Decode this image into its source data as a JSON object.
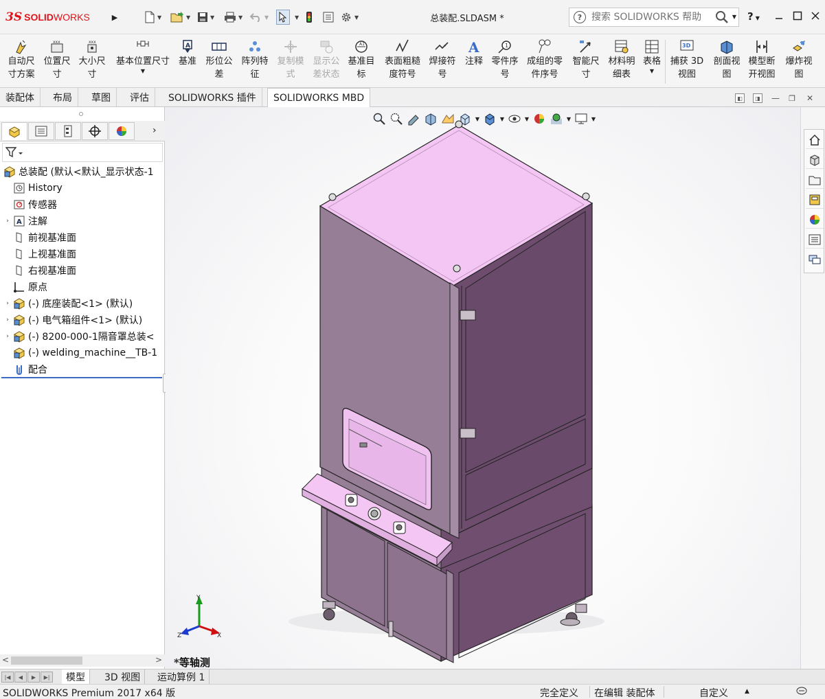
{
  "app": {
    "logo_ds": "3S",
    "logo_solid": "SOLID",
    "logo_works": "WORKS",
    "doc_title": "总装配.SLDASM *",
    "search_placeholder": "搜索 SOLIDWORKS 帮助",
    "help": "?",
    "accent": "#e0131b"
  },
  "ribbon": {
    "buttons": [
      {
        "line1": "自动尺",
        "line2": "寸方案",
        "icon": "auto-dimension-icon"
      },
      {
        "line1": "位置尺",
        "line2": "寸",
        "icon": "location-dimension-icon"
      },
      {
        "line1": "大小尺",
        "line2": "寸",
        "icon": "size-dimension-icon"
      },
      {
        "line1": "基本位置尺寸",
        "line2": "",
        "icon": "basic-location-dimension-icon"
      },
      {
        "line1": "基准",
        "line2": "",
        "icon": "datum-icon"
      },
      {
        "line1": "形位公",
        "line2": "差",
        "icon": "geometric-tolerance-icon"
      },
      {
        "line1": "阵列特",
        "line2": "征",
        "icon": "pattern-feature-icon"
      },
      {
        "line1": "复制模",
        "line2": "式",
        "icon": "copy-scheme-icon"
      },
      {
        "line1": "显示公",
        "line2": "差状态",
        "icon": "show-tolerance-status-icon"
      },
      {
        "line1": "基准目",
        "line2": "标",
        "icon": "datum-target-icon"
      },
      {
        "line1": "表面粗糙",
        "line2": "度符号",
        "icon": "surface-finish-icon"
      },
      {
        "line1": "焊接符",
        "line2": "号",
        "icon": "weld-symbol-icon"
      },
      {
        "line1": "注释",
        "line2": "",
        "icon": "note-icon"
      },
      {
        "line1": "零件序",
        "line2": "号",
        "icon": "balloon-icon"
      },
      {
        "line1": "成组的零",
        "line2": "件序号",
        "icon": "stacked-balloon-icon"
      },
      {
        "line1": "智能尺",
        "line2": "寸",
        "icon": "smart-dimension-icon"
      },
      {
        "line1": "材料明",
        "line2": "细表",
        "icon": "bom-icon"
      },
      {
        "line1": "表格",
        "line2": "",
        "icon": "table-icon"
      },
      {
        "line1": "捕获 3D",
        "line2": "视图",
        "icon": "capture-3d-view-icon"
      },
      {
        "line1": "剖面视",
        "line2": "图",
        "icon": "section-view-icon"
      },
      {
        "line1": "模型断",
        "line2": "开视图",
        "icon": "model-break-view-icon"
      },
      {
        "line1": "爆炸视",
        "line2": "图",
        "icon": "exploded-view-icon"
      }
    ]
  },
  "command_tabs": [
    "装配体",
    "布局",
    "草图",
    "评估",
    "SOLIDWORKS 插件",
    "SOLIDWORKS MBD"
  ],
  "active_command_tab": "SOLIDWORKS MBD",
  "tree": {
    "root": "总装配  (默认<默认_显示状态-1",
    "items": [
      {
        "label": "History",
        "icon": "history-icon",
        "expandable": false
      },
      {
        "label": "传感器",
        "icon": "sensor-icon",
        "expandable": false
      },
      {
        "label": "注解",
        "icon": "annotation-icon",
        "expandable": true
      },
      {
        "label": "前视基准面",
        "icon": "plane-icon",
        "expandable": false
      },
      {
        "label": "上视基准面",
        "icon": "plane-icon",
        "expandable": false
      },
      {
        "label": "右视基准面",
        "icon": "plane-icon",
        "expandable": false
      },
      {
        "label": "原点",
        "icon": "origin-icon",
        "expandable": false
      },
      {
        "label": "(-) 底座装配<1> (默认)",
        "icon": "subassembly-icon",
        "expandable": true
      },
      {
        "label": "(-) 电气箱组件<1> (默认)",
        "icon": "subassembly-icon",
        "expandable": true
      },
      {
        "label": "(-) 8200-000-1隔音罩总装<",
        "icon": "subassembly-icon",
        "expandable": true
      },
      {
        "label": "(-) welding_machine__TB-1",
        "icon": "subassembly-icon",
        "expandable": false
      },
      {
        "label": "配合",
        "icon": "mates-icon",
        "expandable": false
      }
    ]
  },
  "viewport": {
    "view_name": "*等轴测",
    "triad": {
      "x": "X",
      "y": "Y",
      "z": "Z"
    },
    "model_color": "#f4c6f4"
  },
  "bottom_tabs": [
    "模型",
    "3D 视图",
    "运动算例 1"
  ],
  "active_bottom_tab": "模型",
  "status": {
    "product": "SOLIDWORKS Premium 2017 x64 版",
    "definition": "完全定义",
    "editing": "在编辑 装配体",
    "units": "自定义"
  }
}
